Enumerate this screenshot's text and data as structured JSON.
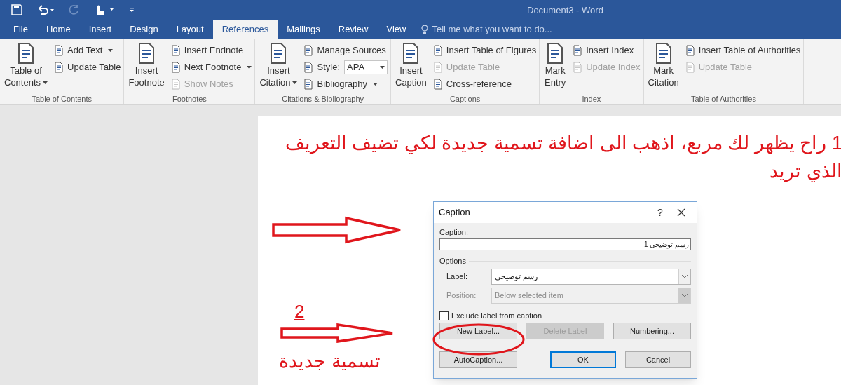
{
  "window": {
    "title": "Document3 - Word"
  },
  "tabs": [
    {
      "label": "File",
      "selected": false
    },
    {
      "label": "Home",
      "selected": false
    },
    {
      "label": "Insert",
      "selected": false
    },
    {
      "label": "Design",
      "selected": false
    },
    {
      "label": "Layout",
      "selected": false
    },
    {
      "label": "References",
      "selected": true
    },
    {
      "label": "Mailings",
      "selected": false
    },
    {
      "label": "Review",
      "selected": false
    },
    {
      "label": "View",
      "selected": false
    }
  ],
  "tell_me": {
    "placeholder": "Tell me what you want to do..."
  },
  "ribbon_groups": [
    {
      "label": "Table of Contents",
      "launcher": false,
      "items": [
        {
          "kind": "large",
          "lines": [
            "Table of",
            "Contents"
          ],
          "menu": true,
          "disabled": false
        },
        {
          "kind": "column",
          "items": [
            {
              "label": "Add Text",
              "menu": true,
              "disabled": false
            },
            {
              "label": "Update Table",
              "menu": false,
              "disabled": false
            }
          ]
        }
      ]
    },
    {
      "label": "Footnotes",
      "launcher": true,
      "items": [
        {
          "kind": "large",
          "lines": [
            "Insert",
            "Footnote"
          ],
          "menu": false,
          "disabled": false
        },
        {
          "kind": "column",
          "items": [
            {
              "label": "Insert Endnote",
              "menu": false,
              "disabled": false
            },
            {
              "label": "Next Footnote",
              "menu": true,
              "disabled": false
            },
            {
              "label": "Show Notes",
              "menu": false,
              "disabled": true
            }
          ]
        }
      ]
    },
    {
      "label": "Citations & Bibliography",
      "launcher": false,
      "items": [
        {
          "kind": "large",
          "lines": [
            "Insert",
            "Citation"
          ],
          "menu": true,
          "disabled": false
        },
        {
          "kind": "column",
          "items": [
            {
              "label": "Manage Sources",
              "menu": false,
              "disabled": false
            },
            {
              "label": "Style:",
              "value": "APA",
              "menu": false,
              "disabled": false
            },
            {
              "label": "Bibliography",
              "menu": true,
              "disabled": false
            }
          ]
        }
      ]
    },
    {
      "label": "Captions",
      "launcher": false,
      "items": [
        {
          "kind": "large",
          "lines": [
            "Insert",
            "Caption"
          ],
          "menu": false,
          "disabled": false
        },
        {
          "kind": "column",
          "items": [
            {
              "label": "Insert Table of Figures",
              "menu": false,
              "disabled": false
            },
            {
              "label": "Update Table",
              "menu": false,
              "disabled": true
            },
            {
              "label": "Cross-reference",
              "menu": false,
              "disabled": false
            }
          ]
        }
      ]
    },
    {
      "label": "Index",
      "launcher": false,
      "items": [
        {
          "kind": "large",
          "lines": [
            "Mark",
            "Entry"
          ],
          "menu": false,
          "disabled": false
        },
        {
          "kind": "column",
          "items": [
            {
              "label": "Insert Index",
              "menu": false,
              "disabled": false
            },
            {
              "label": "Update Index",
              "menu": false,
              "disabled": true
            }
          ]
        }
      ]
    },
    {
      "label": "Table of Authorities",
      "launcher": false,
      "items": [
        {
          "kind": "large",
          "lines": [
            "Mark",
            "Citation"
          ],
          "menu": false,
          "disabled": false
        },
        {
          "kind": "column",
          "items": [
            {
              "label": "Insert Table of Authorities",
              "menu": false,
              "disabled": false
            },
            {
              "label": "Update Table",
              "menu": false,
              "disabled": true
            }
          ]
        }
      ]
    }
  ],
  "document": {
    "instruction": "1 راح يظهر لك مربع، اذهب الى اضافة تسمية جديدة لكي تضيف التعريف الذي تريد",
    "step_number": "2",
    "step_caption": "تسمية جديدة"
  },
  "dialog": {
    "title": "Caption",
    "help": "?",
    "caption_label": "Caption:",
    "caption_value": "رسم توضيحي 1",
    "options_label": "Options",
    "fields": [
      {
        "label": "Label:",
        "value": "رسم توضيحي",
        "disabled": false
      },
      {
        "label": "Position:",
        "value": "Below selected item",
        "disabled": true
      }
    ],
    "exclude": {
      "label": "Exclude label from caption",
      "checked": false
    },
    "buttons": [
      {
        "label": "New Label...",
        "disabled": false,
        "default": false
      },
      {
        "label": "Delete Label",
        "disabled": true,
        "default": false
      },
      {
        "label": "Numbering...",
        "disabled": false,
        "default": false
      },
      {
        "label": "AutoCaption...",
        "disabled": false,
        "default": false
      },
      {
        "label": "OK",
        "disabled": false,
        "default": true
      },
      {
        "label": "Cancel",
        "disabled": false,
        "default": false
      }
    ]
  }
}
